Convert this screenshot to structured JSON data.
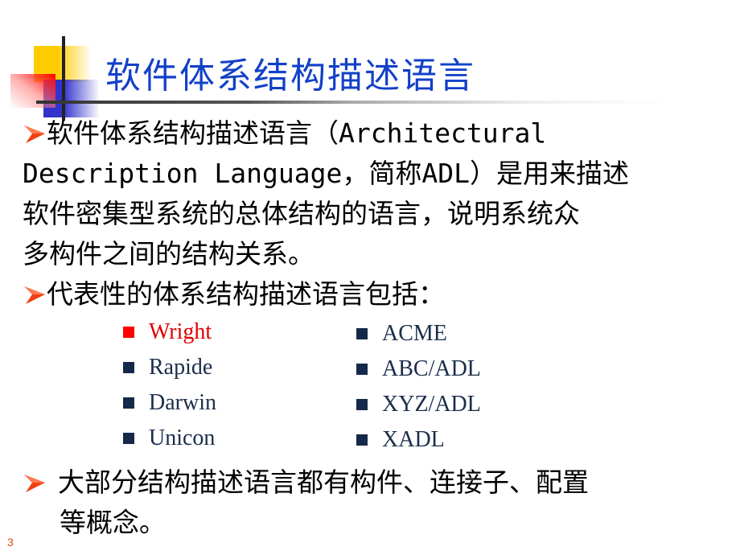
{
  "slide": {
    "title": "软件体系结构描述语言",
    "page_number": "3",
    "colors": {
      "title": "#1240c8",
      "arrow": "#f04010",
      "highlight": "#e00000",
      "bullet": "#16294a",
      "page_number": "#e0491a"
    },
    "bullets": [
      {
        "icon": "arrow-bullet-icon",
        "lines": [
          "软件体系结构描述语言（Architectural",
          "Description Language，简称ADL）是用来描述",
          "软件密集型系统的总体结构的语言，说明系统众",
          "多构件之间的结构关系。"
        ]
      },
      {
        "icon": "arrow-bullet-icon",
        "lines": [
          "代表性的体系结构描述语言包括："
        ]
      },
      {
        "icon": "arrow-bullet-icon",
        "lines": [
          "大部分结构描述语言都有构件、连接子、配置",
          "等概念。"
        ]
      }
    ],
    "adl_list": {
      "left": [
        {
          "label": "Wright",
          "highlight": true
        },
        {
          "label": "Rapide",
          "highlight": false
        },
        {
          "label": "Darwin",
          "highlight": false
        },
        {
          "label": "Unicon",
          "highlight": false
        }
      ],
      "right": [
        {
          "label": "ACME",
          "highlight": false
        },
        {
          "label": "ABC/ADL",
          "highlight": false
        },
        {
          "label": "XYZ/ADL",
          "highlight": false
        },
        {
          "label": "XADL",
          "highlight": false
        }
      ]
    }
  }
}
